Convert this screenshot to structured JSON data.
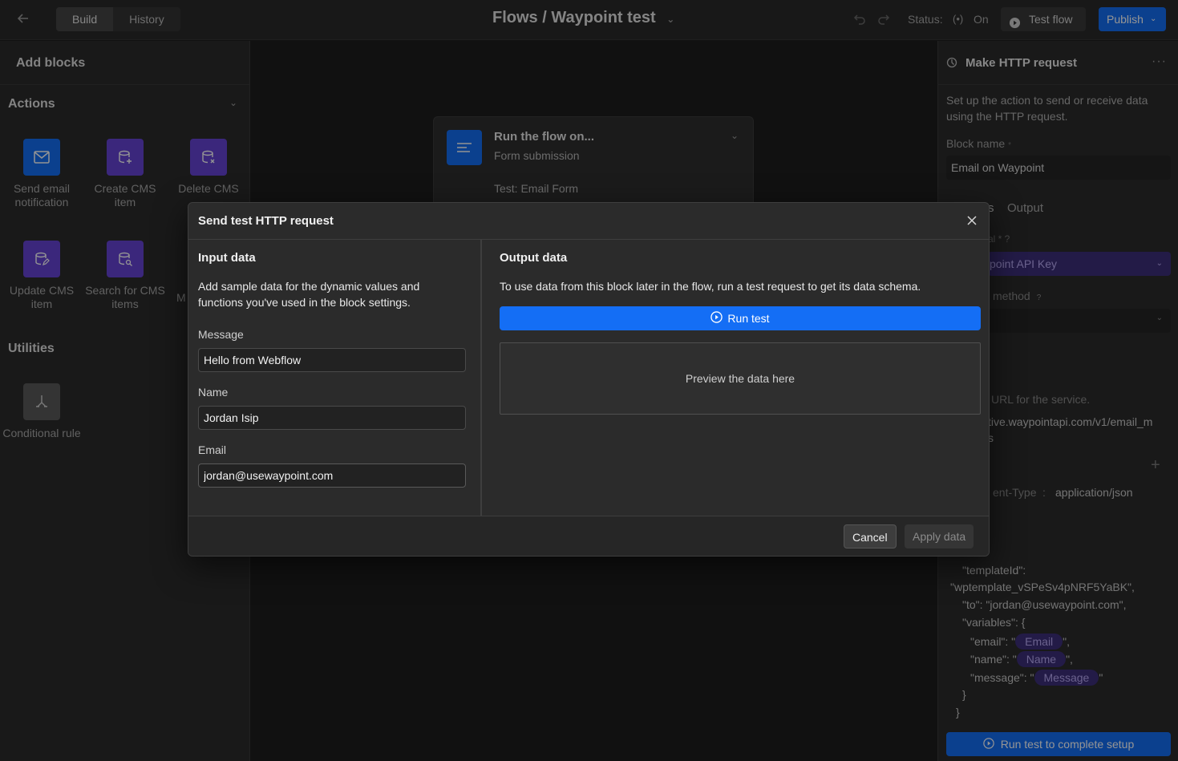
{
  "topbar": {
    "back_icon": "arrow-left-icon",
    "tabs": [
      "Build",
      "History"
    ],
    "title": "Flows / Waypoint test",
    "status_label": "Status:",
    "status_value": "On",
    "test_flow": "Test flow",
    "publish": "Publish"
  },
  "left": {
    "header": "Add blocks",
    "actions_title": "Actions",
    "actions": [
      {
        "label": "Send email notification",
        "icon": "mail-icon"
      },
      {
        "label": "Create CMS item",
        "icon": "database-add-icon"
      },
      {
        "label": "Delete CMS",
        "icon": "database-delete-icon"
      },
      {
        "label": "Update CMS item",
        "icon": "database-edit-icon"
      },
      {
        "label": "Search for CMS items",
        "icon": "database-search-icon"
      }
    ],
    "partial_label": "M",
    "utilities_title": "Utilities",
    "utilities": [
      {
        "label": "Conditional rule",
        "icon": "branch-icon"
      }
    ]
  },
  "canvas": {
    "trigger_title": "Run the flow on...",
    "trigger_sub": "Form submission",
    "trigger_test": "Test: Email Form"
  },
  "right": {
    "title": "Make HTTP request",
    "desc": "Set up the action to send or receive data using the HTTP request.",
    "block_name_label": "Block name",
    "block_name_value": "Email on Waypoint",
    "tab_partial": "s",
    "tab_output": "Output",
    "cred_label_partial": "al",
    "cred_value_partial": "point API Key",
    "method_partial": "method",
    "url_desc_partial": "URL for the service.",
    "url_value_partial": "tive.waypointapi.com/v1/email_m",
    "url_value_partial2": "s",
    "header_key_partial": "ent-Type",
    "header_sep": ":",
    "header_value": "application/json",
    "body_lines": [
      "\"templateId\":",
      "\"wptemplate_vSPeSv4pNRF5YaBK\",",
      "\"to\": \"jordan@usewaypoint.com\",",
      "\"variables\": {",
      "\"email\": \"",
      "\"name\": \"",
      "\"message\": \"",
      "}",
      "}"
    ],
    "pills": [
      "Email",
      "Name",
      "Message"
    ],
    "quote_comma": "\",",
    "quote_end": "\"",
    "run_test_setup": "Run test to complete setup"
  },
  "modal": {
    "title": "Send test HTTP request",
    "input_title": "Input data",
    "input_desc": "Add sample data for the dynamic values and functions you've used in the block settings.",
    "fields": [
      {
        "label": "Message",
        "value": "Hello from Webflow"
      },
      {
        "label": "Name",
        "value": "Jordan Isip"
      },
      {
        "label": "Email",
        "value": "jordan@usewaypoint.com"
      }
    ],
    "output_title": "Output data",
    "output_desc": "To use data from this block later in the flow, run a test request to get its data schema.",
    "run_test": "Run test",
    "preview": "Preview the data here",
    "cancel": "Cancel",
    "apply": "Apply data"
  }
}
